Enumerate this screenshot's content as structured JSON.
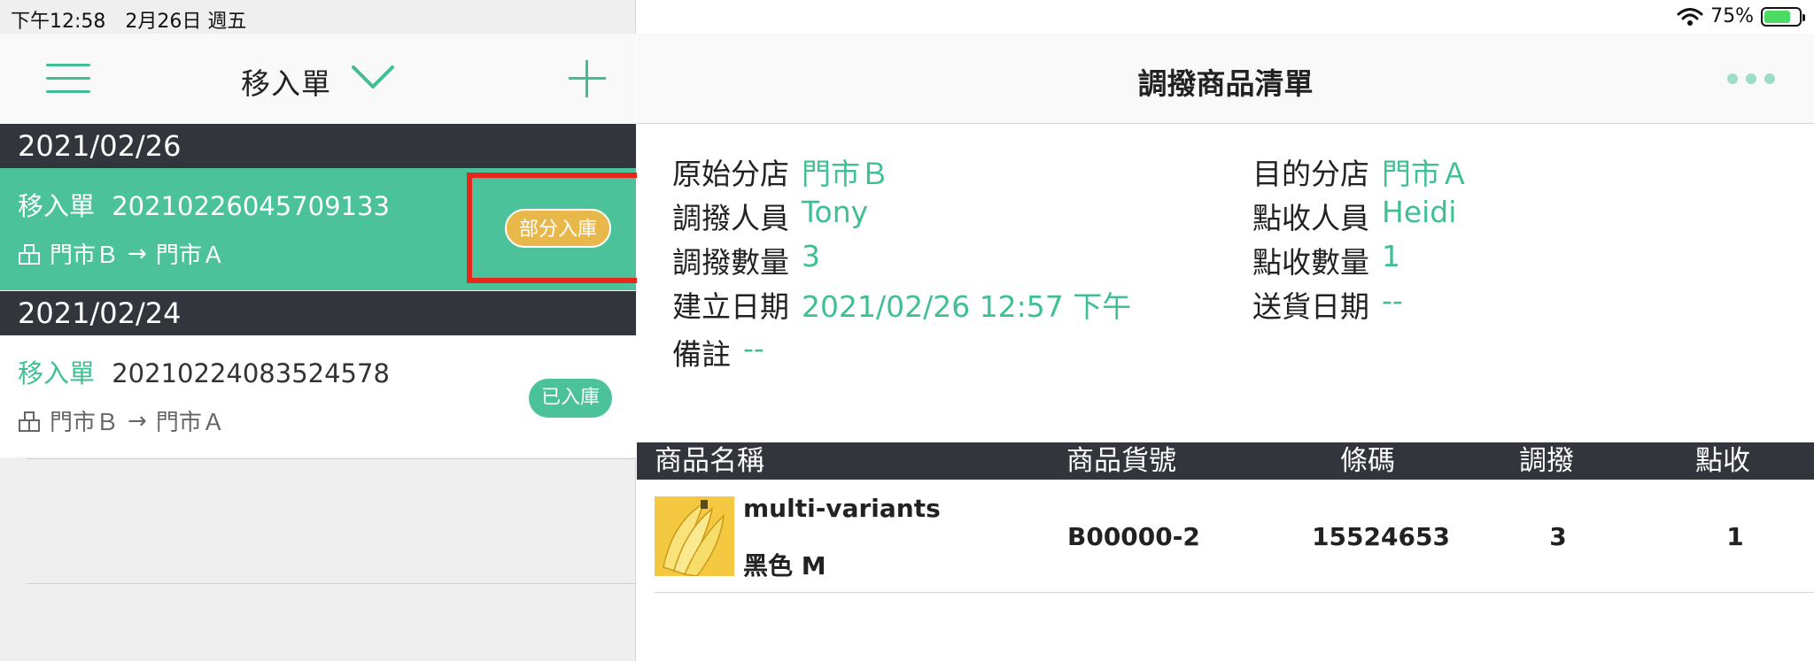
{
  "status_bar": {
    "time": "下午12:58　2月26日 週五",
    "battery": "75%"
  },
  "left": {
    "title": "移入單",
    "groups": [
      {
        "date": "2021/02/26",
        "order": {
          "type": "移入單",
          "id": "20210226045709133",
          "from": "門市Ｂ",
          "arrow": "→",
          "to": "門市Ａ",
          "status": "部分入庫"
        }
      },
      {
        "date": "2021/02/24",
        "order": {
          "type": "移入單",
          "id": "20210224083524578",
          "from": "門市Ｂ",
          "arrow": "→",
          "to": "門市Ａ",
          "status": "已入庫"
        }
      }
    ]
  },
  "right": {
    "title": "調撥商品清單",
    "info": {
      "source_store_label": "原始分店",
      "source_store": "門市Ｂ",
      "dest_store_label": "目的分店",
      "dest_store": "門市Ａ",
      "transfer_person_label": "調撥人員",
      "transfer_person": "Tony",
      "receive_person_label": "點收人員",
      "receive_person": "Heidi",
      "transfer_qty_label": "調撥數量",
      "transfer_qty": "3",
      "receive_qty_label": "點收數量",
      "receive_qty": "1",
      "created_label": "建立日期",
      "created": "2021/02/26 12:57 下午",
      "delivery_label": "送貨日期",
      "delivery": "--",
      "note_label": "備註",
      "note": "--"
    },
    "table": {
      "columns": [
        "商品名稱",
        "商品貨號",
        "條碼",
        "調撥",
        "點收"
      ],
      "rows": [
        {
          "name": "multi-variants",
          "variant": "黑色 M",
          "sku": "B00000-2",
          "barcode": "15524653",
          "transfer": "3",
          "received": "1"
        }
      ]
    }
  },
  "colors": {
    "accent": "#3fbf96",
    "selected_row": "#4bc29a",
    "dark_header": "#32363c",
    "partial_badge": "#e8b94a",
    "highlight": "#e8271c"
  },
  "icons": [
    "wifi-icon",
    "battery-icon",
    "hamburger-menu-icon",
    "chevron-down-icon",
    "plus-icon",
    "store-icon",
    "right-arrow-icon",
    "more-icon",
    "banana-product-image"
  ]
}
